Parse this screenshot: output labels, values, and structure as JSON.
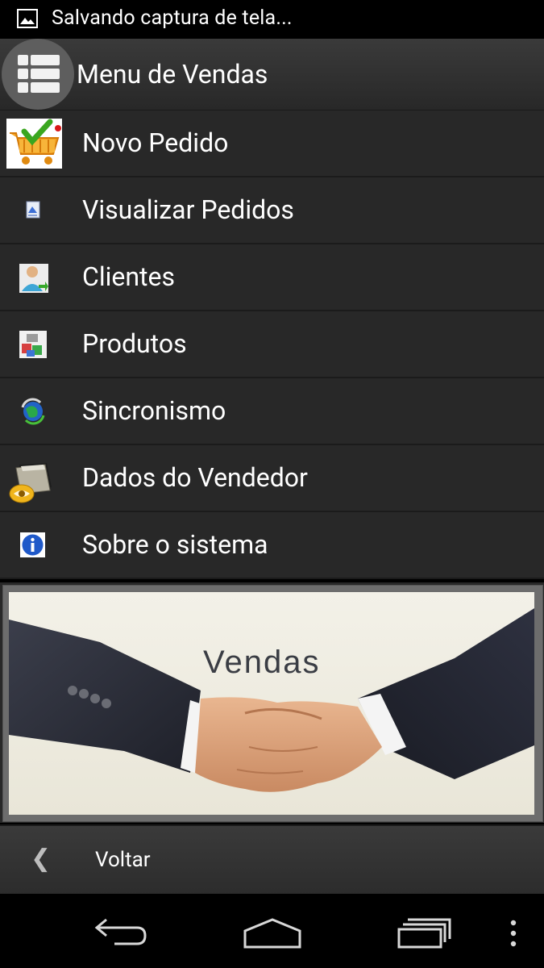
{
  "status_bar": {
    "text": "Salvando captura de tela...",
    "icon": "image-icon"
  },
  "action_bar": {
    "title": "Menu de Vendas",
    "icon": "list-menu-icon"
  },
  "menu": {
    "items": [
      {
        "label": "Novo Pedido",
        "icon": "shopping-cart-icon"
      },
      {
        "label": "Visualizar Pedidos",
        "icon": "document-icon"
      },
      {
        "label": "Clientes",
        "icon": "user-icon"
      },
      {
        "label": "Produtos",
        "icon": "products-icon"
      },
      {
        "label": "Sincronismo",
        "icon": "sync-globe-icon"
      },
      {
        "label": "Dados do Vendedor",
        "icon": "folder-eye-icon"
      },
      {
        "label": "Sobre o sistema",
        "icon": "info-icon"
      }
    ]
  },
  "banner": {
    "text": "Vendas",
    "image": "handshake-image"
  },
  "back_bar": {
    "label": "Voltar",
    "icon": "chevron-left-icon"
  },
  "nav_bar": {
    "icons": [
      "back-icon",
      "home-icon",
      "recents-icon",
      "overflow-icon"
    ]
  },
  "colors": {
    "background": "#282828",
    "divider": "#1b1b1b",
    "text": "#ffffff"
  }
}
